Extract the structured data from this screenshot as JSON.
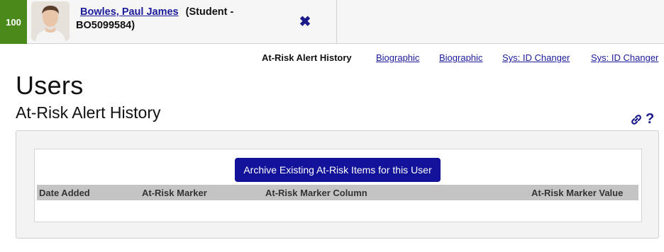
{
  "student": {
    "score": "100",
    "name": "Bowles, Paul James",
    "detail_line1": "(Student -",
    "detail_line2": "BO5099584)",
    "close_icon": "close-icon"
  },
  "nav": {
    "active": "At-Risk Alert History",
    "links": [
      "Biographic",
      "Biographic",
      "Sys: ID Changer",
      "Sys: ID Changer"
    ]
  },
  "page": {
    "title": "Users",
    "subtitle": "At-Risk Alert History"
  },
  "panel": {
    "archive_label": "Archive Existing At-Risk Items for this User",
    "columns": [
      "Date Added",
      "At-Risk Marker",
      "At-Risk Marker Column",
      "At-Risk Marker Value"
    ]
  },
  "colors": {
    "score_bg": "#4a8a1a",
    "link": "#1a1a9a",
    "button_bg": "#12129a"
  }
}
